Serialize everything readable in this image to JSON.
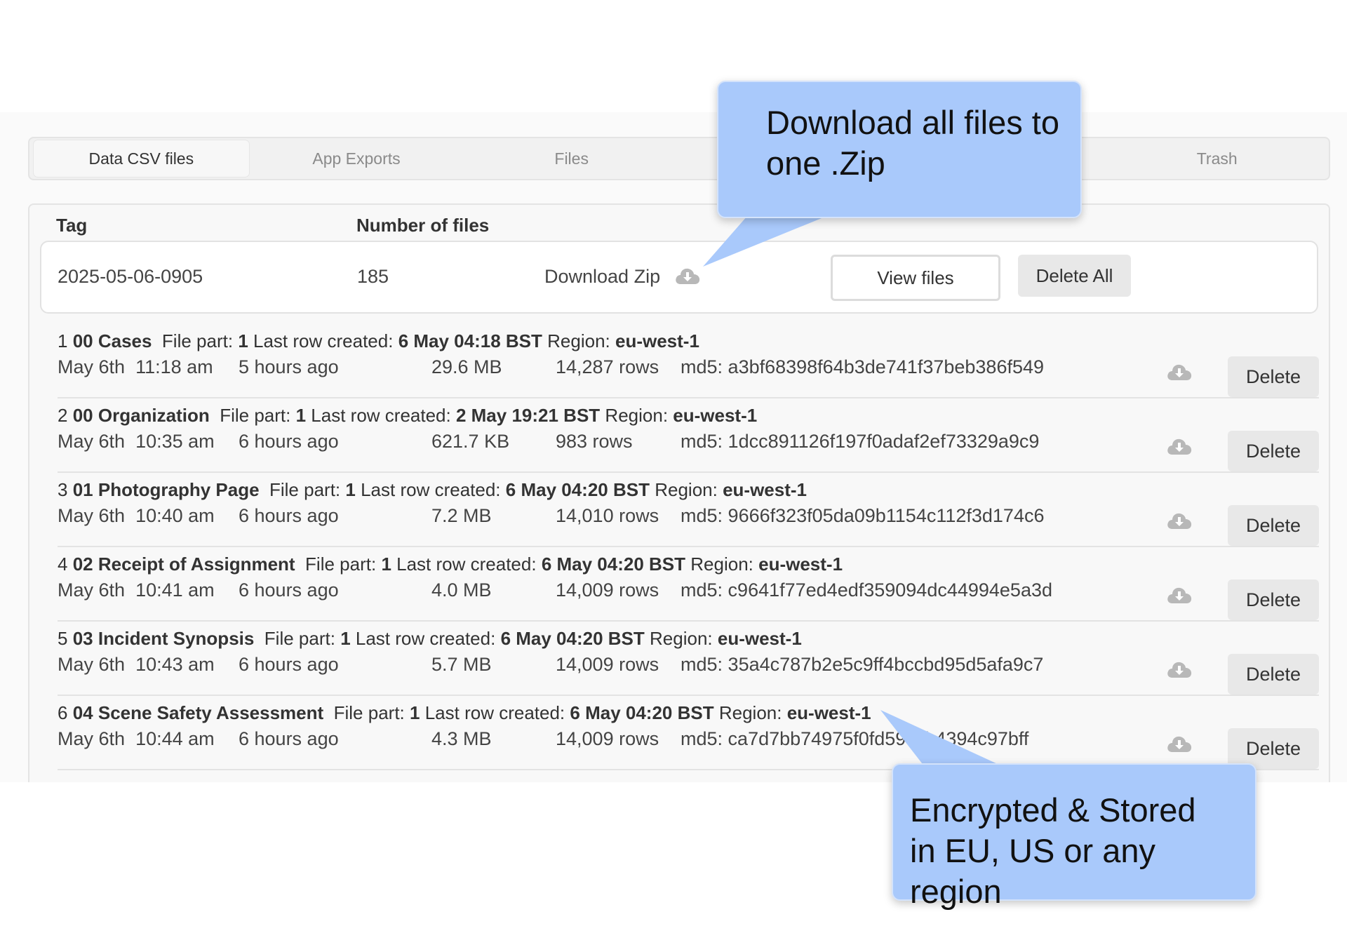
{
  "tabs": [
    {
      "label": "Data CSV files",
      "active": true
    },
    {
      "label": "App Exports",
      "active": false
    },
    {
      "label": "Files",
      "active": false
    },
    {
      "label": "",
      "active": false
    },
    {
      "label": "",
      "active": false
    },
    {
      "label": "Trash",
      "active": false
    }
  ],
  "table_header": {
    "tag": "Tag",
    "number_of_files": "Number of files"
  },
  "tag_row": {
    "tag": "2025-05-06-0905",
    "count": "185",
    "download_label": "Download Zip",
    "view_label": "View files",
    "delete_all_label": "Delete All"
  },
  "labels": {
    "file_part": "File part:",
    "last_row_created": "Last row created:",
    "region": "Region:",
    "md5": "md5:",
    "delete": "Delete"
  },
  "files": [
    {
      "index": "1",
      "name": "00 Cases",
      "part": "1",
      "last_row": "6 May 04:18 BST",
      "region": "eu-west-1",
      "date": "May 6th",
      "time": "11:18 am",
      "ago": "5 hours ago",
      "size": "29.6 MB",
      "rows": "14,287 rows",
      "md5": "a3bf68398f64b3de741f37beb386f549"
    },
    {
      "index": "2",
      "name": "00 Organization",
      "part": "1",
      "last_row": "2 May 19:21 BST",
      "region": "eu-west-1",
      "date": "May 6th",
      "time": "10:35 am",
      "ago": "6 hours ago",
      "size": "621.7 KB",
      "rows": "983 rows",
      "md5": "1dcc891126f197f0adaf2ef73329a9c9"
    },
    {
      "index": "3",
      "name": "01 Photography Page",
      "part": "1",
      "last_row": "6 May 04:20 BST",
      "region": "eu-west-1",
      "date": "May 6th",
      "time": "10:40 am",
      "ago": "6 hours ago",
      "size": "7.2 MB",
      "rows": "14,010 rows",
      "md5": "9666f323f05da09b1154c112f3d174c6"
    },
    {
      "index": "4",
      "name": "02 Receipt of Assignment",
      "part": "1",
      "last_row": "6 May 04:20 BST",
      "region": "eu-west-1",
      "date": "May 6th",
      "time": "10:41 am",
      "ago": "6 hours ago",
      "size": "4.0 MB",
      "rows": "14,009 rows",
      "md5": "c9641f77ed4edf359094dc44994e5a3d"
    },
    {
      "index": "5",
      "name": "03 Incident Synopsis",
      "part": "1",
      "last_row": "6 May 04:20 BST",
      "region": "eu-west-1",
      "date": "May 6th",
      "time": "10:43 am",
      "ago": "6 hours ago",
      "size": "5.7 MB",
      "rows": "14,009 rows",
      "md5": "35a4c787b2e5c9ff4bccbd95d5afa9c7"
    },
    {
      "index": "6",
      "name": "04 Scene Safety Assessment",
      "part": "1",
      "last_row": "6 May 04:20 BST",
      "region": "eu-west-1",
      "date": "May 6th",
      "time": "10:44 am",
      "ago": "6 hours ago",
      "size": "4.3 MB",
      "rows": "14,009 rows",
      "md5": "ca7d7bb74975f0fd59…b4394c97bff"
    }
  ],
  "callouts": {
    "zip_line1": "Download all files to",
    "zip_line2": "one .Zip",
    "region_line1": "Encrypted & Stored",
    "region_line2": "in EU, US or any region"
  },
  "colors": {
    "callout": "#a9c9fb",
    "icon": "#b8b8b8",
    "button": "#e8e8e8"
  },
  "icons": {
    "download": "cloud-download-icon"
  }
}
